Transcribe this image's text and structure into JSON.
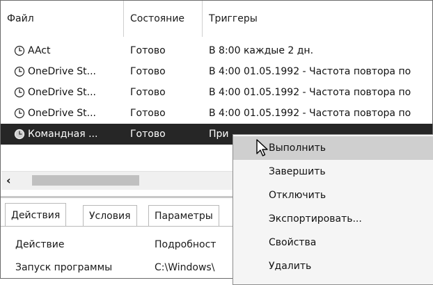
{
  "task_list": {
    "columns": [
      "Файл",
      "Состояние",
      "Триггеры"
    ],
    "rows": [
      {
        "name": "AAct",
        "status": "Готово",
        "trigger": "В 8:00 каждые 2 дн."
      },
      {
        "name": "OneDrive St...",
        "status": "Готово",
        "trigger": "В 4:00 01.05.1992 - Частота повтора по"
      },
      {
        "name": "OneDrive St...",
        "status": "Готово",
        "trigger": "В 4:00 01.05.1992 - Частота повтора по"
      },
      {
        "name": "OneDrive St...",
        "status": "Готово",
        "trigger": "В 4:00 01.05.1992 - Частота повтора по"
      },
      {
        "name": "Командная ...",
        "status": "Готово",
        "trigger": "При"
      }
    ],
    "scroll_left_glyph": "‹"
  },
  "bottom_pane": {
    "tabs": [
      "Действия",
      "Условия",
      "Параметры"
    ],
    "columns": [
      "Действие",
      "Подробност"
    ],
    "rows": [
      {
        "action": "Запуск программы",
        "details": "C:\\Windows\\"
      }
    ]
  },
  "context_menu": {
    "items": [
      "Выполнить",
      "Завершить",
      "Отключить",
      "Экспортировать...",
      "Свойства",
      "Удалить"
    ],
    "highlighted_index": 0
  },
  "colors": {
    "selected_row": "#262626",
    "menu_background": "#f5f5f5",
    "menu_highlight": "#cfcfcf"
  },
  "icons": {
    "task_icon": "clock-icon",
    "pointer": "mouse-cursor-icon"
  }
}
